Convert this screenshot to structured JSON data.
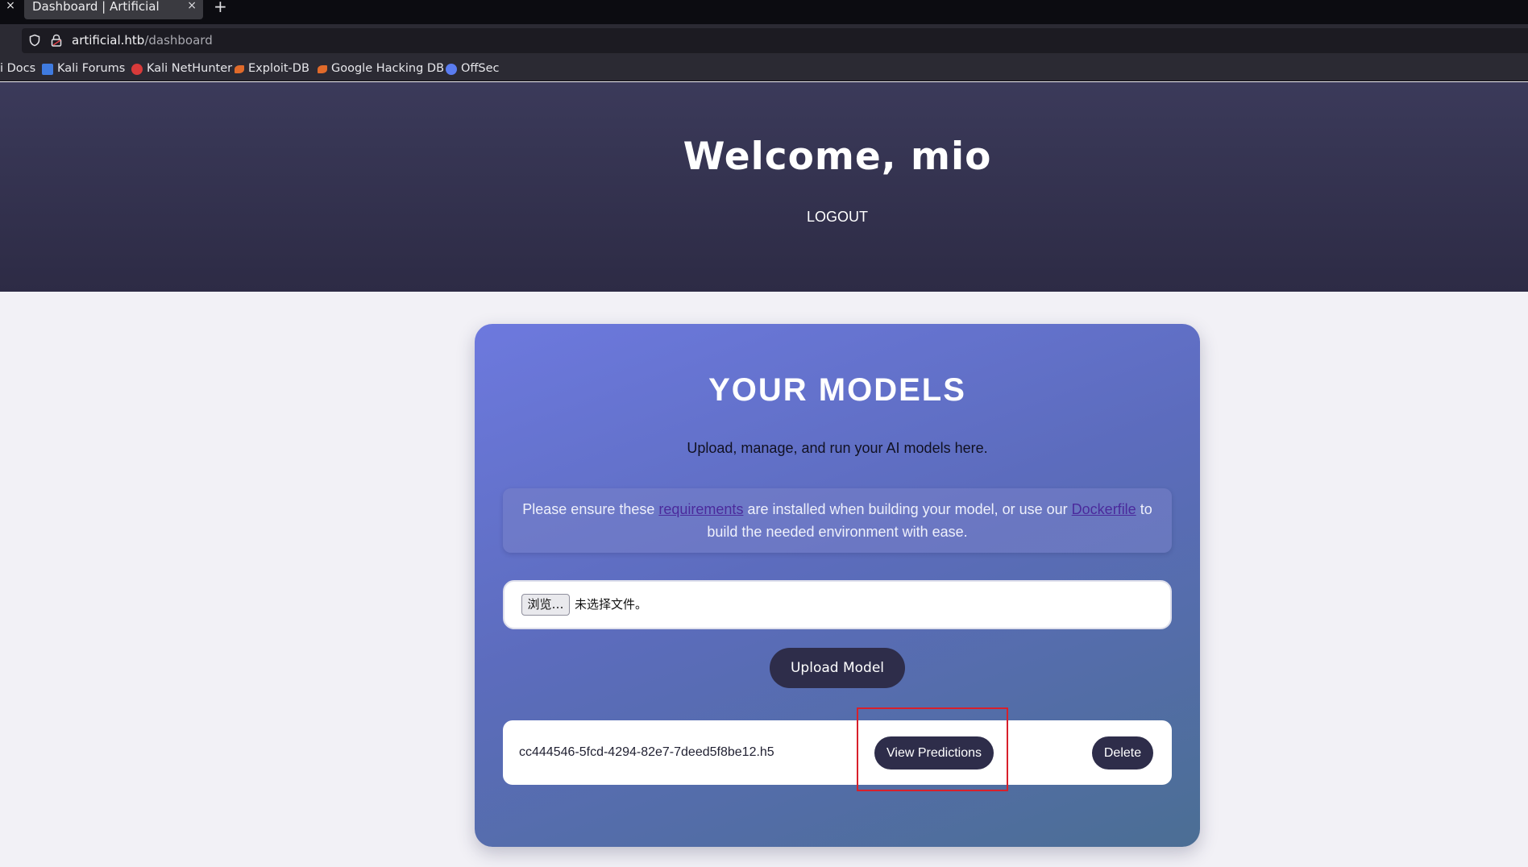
{
  "browser": {
    "tab_title": "Dashboard | Artificial",
    "tab_close_glyph": "×",
    "new_tab_glyph": "+",
    "left_close_glyph": "×",
    "url_host": "artificial.htb",
    "url_path": "/dashboard",
    "bookmarks": [
      {
        "label": "i Docs",
        "icon": "none"
      },
      {
        "label": "Kali Forums",
        "icon": "kali-forums-icon",
        "color": "#3f7be0"
      },
      {
        "label": "Kali NetHunter",
        "icon": "nethunter-icon",
        "color": "#d83a3a"
      },
      {
        "label": "Exploit-DB",
        "icon": "exploit-db-icon",
        "color": "#e06a2a"
      },
      {
        "label": "Google Hacking DB",
        "icon": "ghdb-icon",
        "color": "#e06a2a"
      },
      {
        "label": "OffSec",
        "icon": "offsec-icon",
        "color": "#5a7cf0"
      }
    ]
  },
  "header": {
    "welcome": "Welcome, mio",
    "logout": "LOGOUT"
  },
  "models": {
    "title": "YOUR MODELS",
    "subtitle": "Upload, manage, and run your AI models here.",
    "notice_pre": "Please ensure these ",
    "notice_link1": "requirements",
    "notice_mid": " are installed when building your model, or use our ",
    "notice_link2": "Dockerfile",
    "notice_post": " to build the needed environment with ease.",
    "browse_label": "浏览…",
    "no_file_label": "未选择文件。",
    "upload_label": "Upload Model",
    "items": [
      {
        "name": "cc444546-5fcd-4294-82e7-7deed5f8be12.h5",
        "view_label": "View Predictions",
        "delete_label": "Delete"
      }
    ]
  },
  "colors": {
    "hero_bg": "#34334f",
    "card_gradient_start": "#6d79de",
    "card_gradient_end": "#4b6e94",
    "button_bg": "#2e2d4a",
    "annotation_box": "#d8202b"
  }
}
